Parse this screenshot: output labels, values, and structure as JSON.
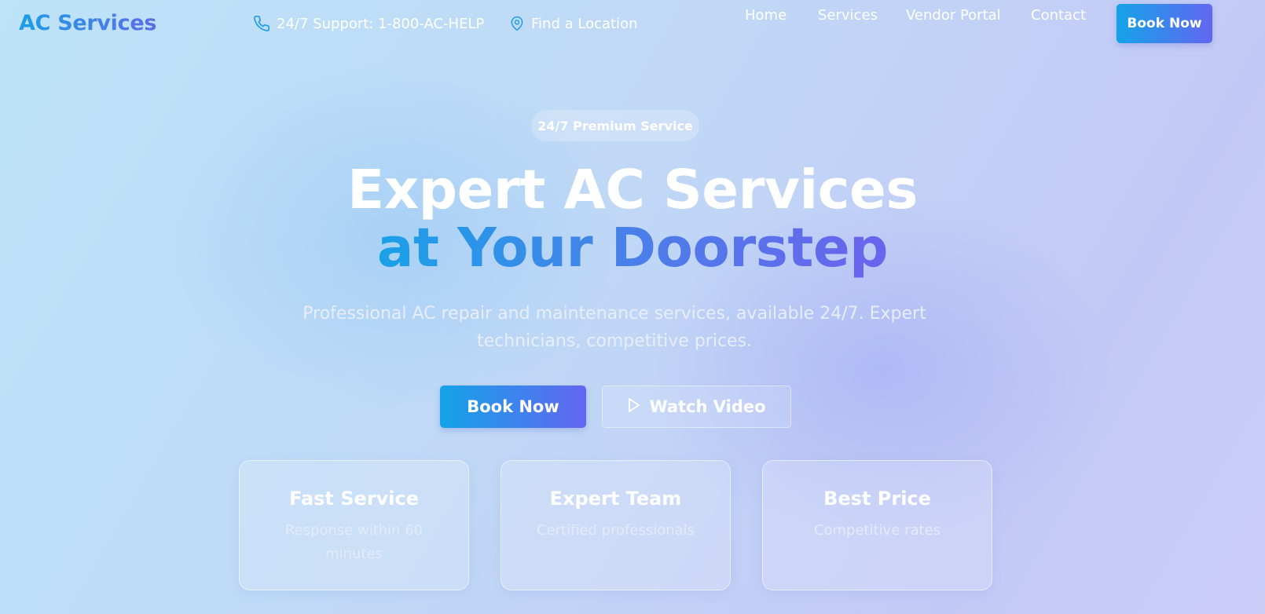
{
  "header": {
    "logo": "AC Services",
    "support_text": "24/7 Support: 1-800-AC-HELP",
    "support_icon": "phone-icon",
    "location_text": "Find a Location",
    "location_icon": "map-pin-icon",
    "nav": [
      {
        "label": "Home"
      },
      {
        "label": "Services"
      },
      {
        "label": "Vendor Portal"
      },
      {
        "label": "Contact"
      }
    ],
    "book_label": "Book Now"
  },
  "hero": {
    "badge": "24/7 Premium Service",
    "title_line1": "Expert AC Services",
    "title_line2": "at Your Doorstep",
    "subtitle": "Professional AC repair and maintenance services, available 24/7. Expert technicians, competitive prices.",
    "primary_label": "Book Now",
    "secondary_label": "Watch Video",
    "secondary_icon": "play-icon"
  },
  "features": [
    {
      "title": "Fast Service",
      "desc": "Response within 60 minutes"
    },
    {
      "title": "Expert Team",
      "desc": "Certified professionals"
    },
    {
      "title": "Best Price",
      "desc": "Competitive rates"
    }
  ],
  "colors": {
    "accent_start": "#14a3e8",
    "accent_end": "#6366f1",
    "text_white": "#ffffff"
  }
}
